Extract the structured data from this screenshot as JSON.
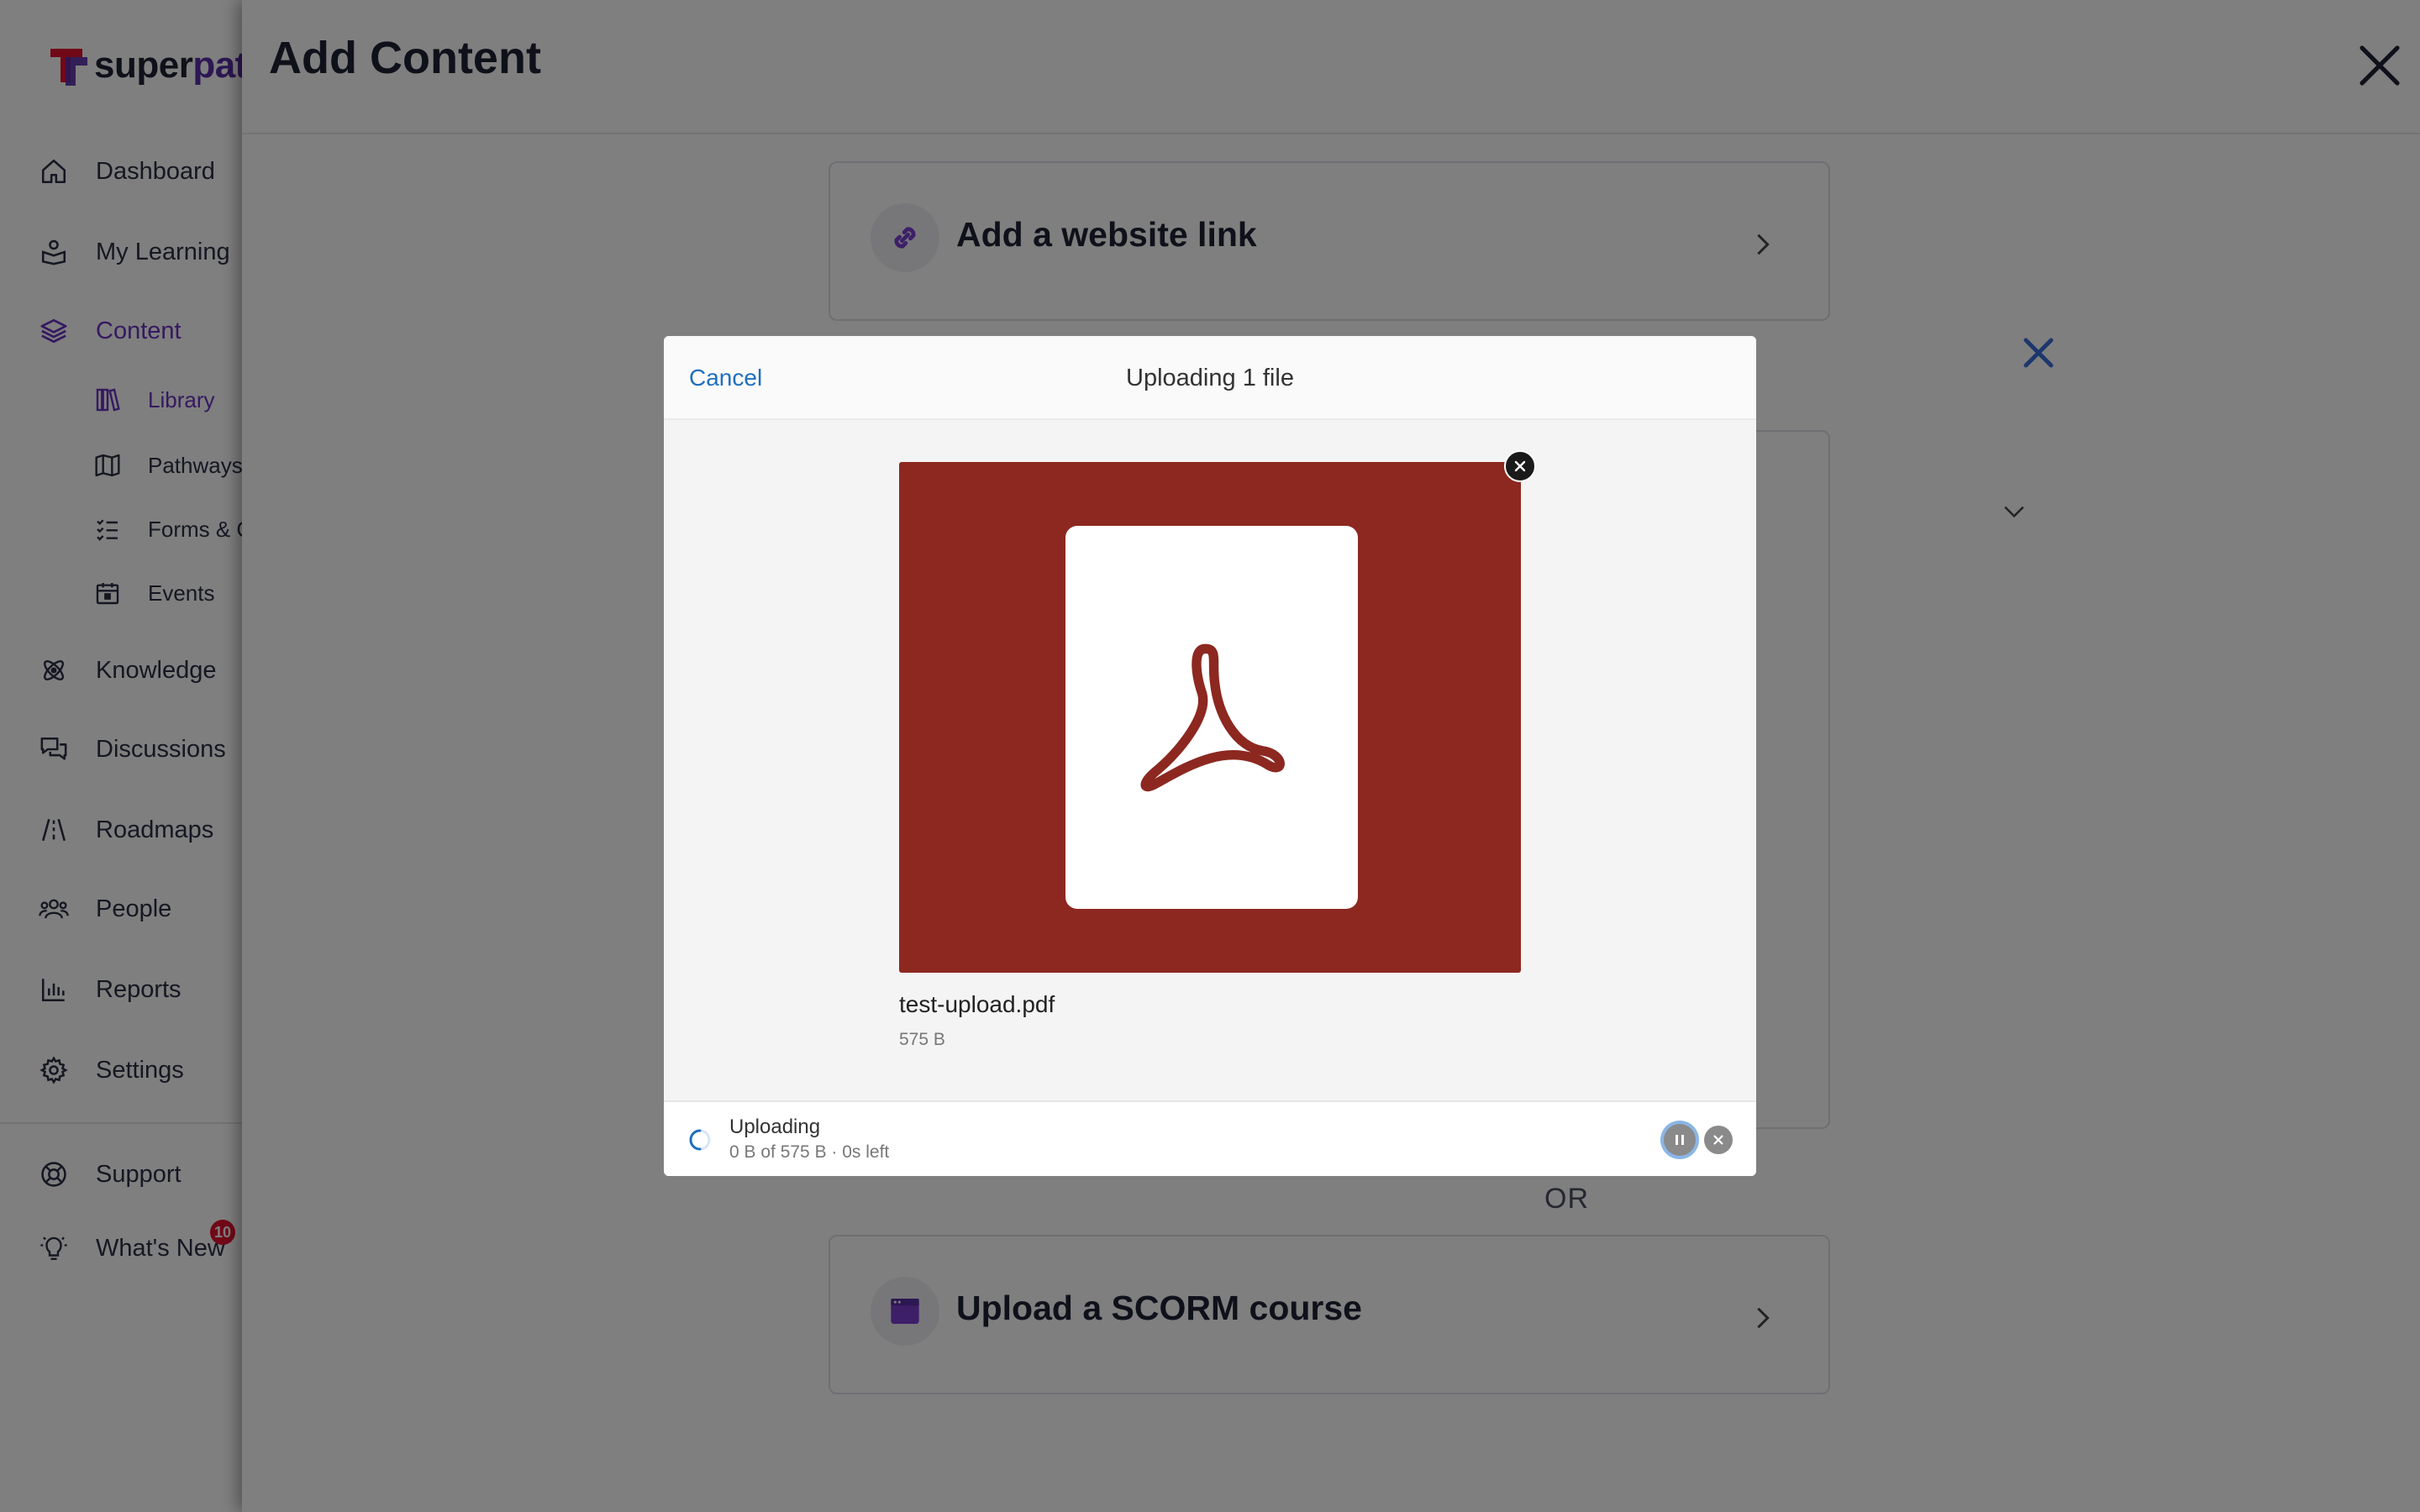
{
  "brand": {
    "logo_part1": "super",
    "logo_part2": "path",
    "accent": "#6a32c2",
    "logo_red": "#e3102f"
  },
  "sidebar": {
    "items": [
      {
        "label": "Dashboard",
        "icon": "home-icon"
      },
      {
        "label": "My Learning",
        "icon": "learner-icon"
      },
      {
        "label": "Content",
        "icon": "layers-icon",
        "active": true
      },
      {
        "label": "Knowledge",
        "icon": "atom-icon"
      },
      {
        "label": "Discussions",
        "icon": "chat-bubbles-icon"
      },
      {
        "label": "Roadmaps",
        "icon": "road-icon"
      },
      {
        "label": "People",
        "icon": "people-icon"
      },
      {
        "label": "Reports",
        "icon": "bar-chart-icon"
      },
      {
        "label": "Settings",
        "icon": "gear-icon"
      },
      {
        "label": "Support",
        "icon": "lifebuoy-icon"
      },
      {
        "label": "What's New",
        "icon": "lightbulb-icon",
        "badge": "10"
      }
    ],
    "subitems": [
      {
        "label": "Library",
        "icon": "books-icon",
        "active": true
      },
      {
        "label": "Pathways",
        "icon": "map-icon"
      },
      {
        "label": "Forms & Q",
        "icon": "checklist-icon"
      },
      {
        "label": "Events",
        "icon": "calendar-icon"
      }
    ]
  },
  "main": {
    "title": "Add Content",
    "cards": [
      {
        "label": "Add a website link",
        "icon": "link-icon"
      },
      {
        "label": "Upload a SCORM course",
        "icon": "scorm-icon"
      }
    ],
    "or_label": "OR"
  },
  "modal": {
    "cancel_label": "Cancel",
    "title": "Uploading 1 file",
    "file": {
      "name": "test-upload.pdf",
      "size": "575 B",
      "icon": "pdf-icon"
    },
    "status": {
      "title": "Uploading",
      "detail": "0 B of 575 B · 0s left",
      "progress_percent": 0
    }
  }
}
